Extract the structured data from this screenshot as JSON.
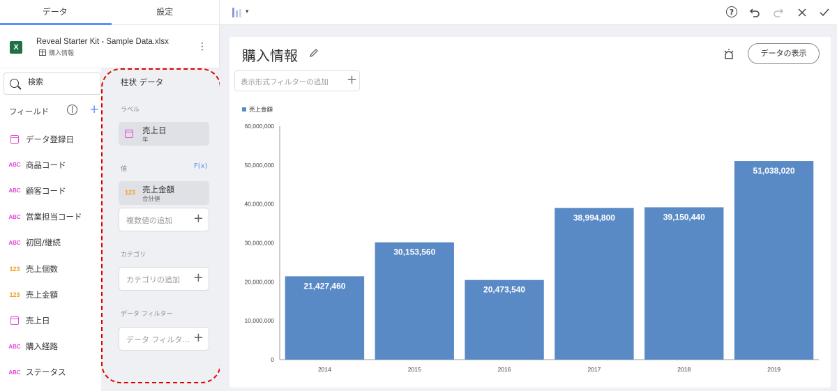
{
  "tabs": [
    {
      "label": "データ",
      "active": true
    },
    {
      "label": "設定",
      "active": false
    }
  ],
  "datasource": {
    "title": "Reveal Starter Kit - Sample Data.xlsx",
    "sheet": "購入情報",
    "icon_text": "X"
  },
  "search": {
    "placeholder": "検索"
  },
  "fields": {
    "header": "フィールド",
    "items": [
      {
        "label": "データ登録日",
        "type": "date"
      },
      {
        "label": "商品コード",
        "type": "text"
      },
      {
        "label": "顧客コード",
        "type": "text"
      },
      {
        "label": "営業担当コード",
        "type": "text"
      },
      {
        "label": "初回/継続",
        "type": "text"
      },
      {
        "label": "売上個数",
        "type": "number"
      },
      {
        "label": "売上金額",
        "type": "number"
      },
      {
        "label": "売上日",
        "type": "date"
      },
      {
        "label": "購入経路",
        "type": "text"
      },
      {
        "label": "ステータス",
        "type": "text"
      }
    ],
    "type_text_glyph": "ABC",
    "type_number_glyph": "123"
  },
  "config": {
    "title": "柱状 データ",
    "label_section": "ラベル",
    "label_field": {
      "name": "売上日",
      "sub": "年"
    },
    "value_section": "値",
    "fx": "F(x)",
    "value_field": {
      "name": "売上金額",
      "sub": "合計値",
      "glyph": "123"
    },
    "add_value": "複数値の追加",
    "category_section": "カテゴリ",
    "add_category": "カテゴリの追加",
    "filter_section": "データ フィルター",
    "add_filter": "データ フィルタ…"
  },
  "toolbar": {
    "help": "?"
  },
  "card": {
    "title": "購入情報",
    "view_button": "データの表示",
    "filter_placeholder": "表示形式フィルターの追加"
  },
  "colors": {
    "bar": "#5a8ac6",
    "accent": "#5b8ff9",
    "highlight": "#e00000"
  },
  "chart_data": {
    "type": "bar",
    "categories": [
      "2014",
      "2015",
      "2016",
      "2017",
      "2018",
      "2019"
    ],
    "series": [
      {
        "name": "売上金額",
        "values": [
          21427460,
          30153560,
          20473540,
          38994800,
          39150440,
          51038020
        ]
      }
    ],
    "data_labels": [
      "21,427,460",
      "30,153,560",
      "20,473,540",
      "38,994,800",
      "39,150,440",
      "51,038,020"
    ],
    "y_ticks": [
      "0",
      "10,000,000",
      "20,000,000",
      "30,000,000",
      "40,000,000",
      "50,000,000",
      "60,000,000"
    ],
    "ylim": [
      0,
      60000000
    ],
    "legend": "top-left",
    "grid": false
  }
}
